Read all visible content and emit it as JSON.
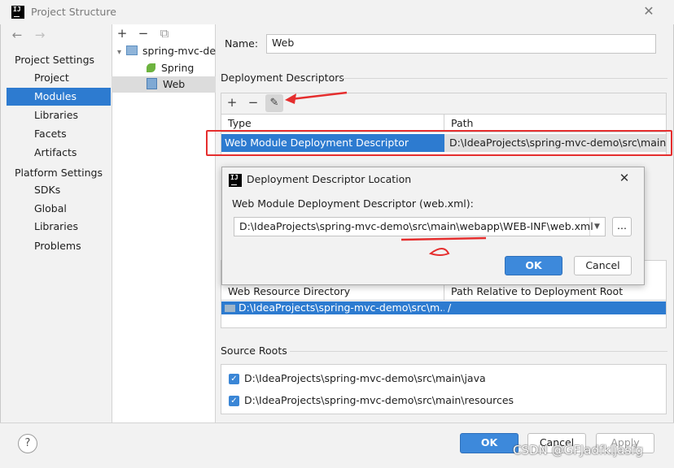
{
  "window": {
    "title": "Project Structure",
    "logo_text": "IJ"
  },
  "nav": {
    "project_settings_header": "Project Settings",
    "project_items": [
      "Project",
      "Modules",
      "Libraries",
      "Facets",
      "Artifacts"
    ],
    "selected": "Modules",
    "platform_settings_header": "Platform Settings",
    "platform_items": [
      "SDKs",
      "Global Libraries"
    ],
    "problems": "Problems"
  },
  "tree": {
    "root": "spring-mvc-de",
    "children": [
      "Spring",
      "Web"
    ],
    "selected": "Web"
  },
  "form": {
    "name_label": "Name:",
    "name_value": "Web"
  },
  "deployment": {
    "header": "Deployment Descriptors",
    "col_type": "Type",
    "col_path": "Path",
    "row_type": "Web Module Deployment Descriptor",
    "row_path": "D:\\IdeaProjects\\spring-mvc-demo\\src\\main\\w"
  },
  "dialog": {
    "title": "Deployment Descriptor Location",
    "field_label": "Web Module Deployment Descriptor (web.xml):",
    "field_value": "D:\\IdeaProjects\\spring-mvc-demo\\src\\main\\webapp\\WEB-INF\\web.xml",
    "browse_label": "...",
    "ok_label": "OK",
    "cancel_label": "Cancel"
  },
  "resources": {
    "col_dir": "Web Resource Directory",
    "col_rel": "Path Relative to Deployment Root",
    "row_dir": "D:\\IdeaProjects\\spring-mvc-demo\\src\\m...",
    "row_rel": "/"
  },
  "source_roots": {
    "header": "Source Roots",
    "items": [
      "D:\\IdeaProjects\\spring-mvc-demo\\src\\main\\java",
      "D:\\IdeaProjects\\spring-mvc-demo\\src\\main\\resources"
    ]
  },
  "footer": {
    "ok_label": "OK",
    "cancel_label": "Cancel",
    "apply_label": "Apply",
    "help_label": "?"
  },
  "watermark": "CSDN @GFJadfkljasfg",
  "colors": {
    "selection": "#2d7bd0",
    "annotation": "#e52e2e",
    "accent_button": "#3d89db"
  }
}
